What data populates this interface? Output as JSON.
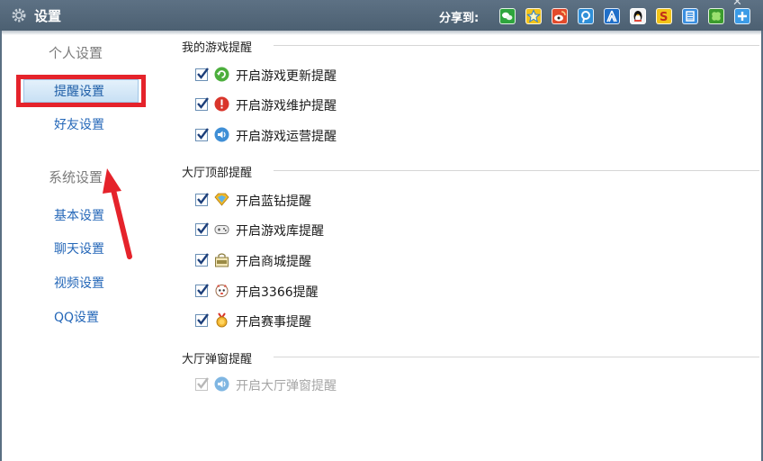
{
  "window": {
    "title": "设置",
    "share_label": "分享到:",
    "share_icons": [
      "wechat-icon",
      "qzone-star-icon",
      "weibo-icon",
      "tencent-weibo-icon",
      "renren-icon",
      "qq-penguin-icon",
      "kaixin-icon",
      "tieba-icon",
      "clover-icon",
      "add-more-icon"
    ],
    "close_glyph": "✕"
  },
  "sidebar": {
    "group_personal": "个人设置",
    "items_personal": [
      "提醒设置",
      "好友设置"
    ],
    "selected_item": "提醒设置",
    "group_system": "系统设置",
    "items_system": [
      "基本设置",
      "聊天设置",
      "视频设置",
      "QQ设置"
    ]
  },
  "sections": [
    {
      "title": "我的游戏提醒",
      "options": [
        {
          "label": "开启游戏更新提醒",
          "icon": "update-icon",
          "checked": true,
          "disabled": false
        },
        {
          "label": "开启游戏维护提醒",
          "icon": "warning-icon",
          "checked": true,
          "disabled": false
        },
        {
          "label": "开启游戏运营提醒",
          "icon": "speaker-icon",
          "checked": true,
          "disabled": false
        }
      ]
    },
    {
      "title": "大厅顶部提醒",
      "options": [
        {
          "label": "开启蓝钻提醒",
          "icon": "blue-diamond-icon",
          "checked": true,
          "disabled": false
        },
        {
          "label": "开启游戏库提醒",
          "icon": "gamepad-icon",
          "checked": true,
          "disabled": false
        },
        {
          "label": "开启商城提醒",
          "icon": "shop-icon",
          "checked": true,
          "disabled": false
        },
        {
          "label": "开启3366提醒",
          "icon": "3366-mascot-icon",
          "checked": true,
          "disabled": false
        },
        {
          "label": "开启赛事提醒",
          "icon": "medal-icon",
          "checked": true,
          "disabled": false
        }
      ]
    },
    {
      "title": "大厅弹窗提醒",
      "options": [
        {
          "label": "开启大厅弹窗提醒",
          "icon": "speaker-icon",
          "checked": true,
          "disabled": true
        }
      ]
    }
  ],
  "colors": {
    "titlebar": "#55697c",
    "highlight_box": "#e5232b",
    "arrow": "#e5232b",
    "link_blue": "#2467b8"
  }
}
